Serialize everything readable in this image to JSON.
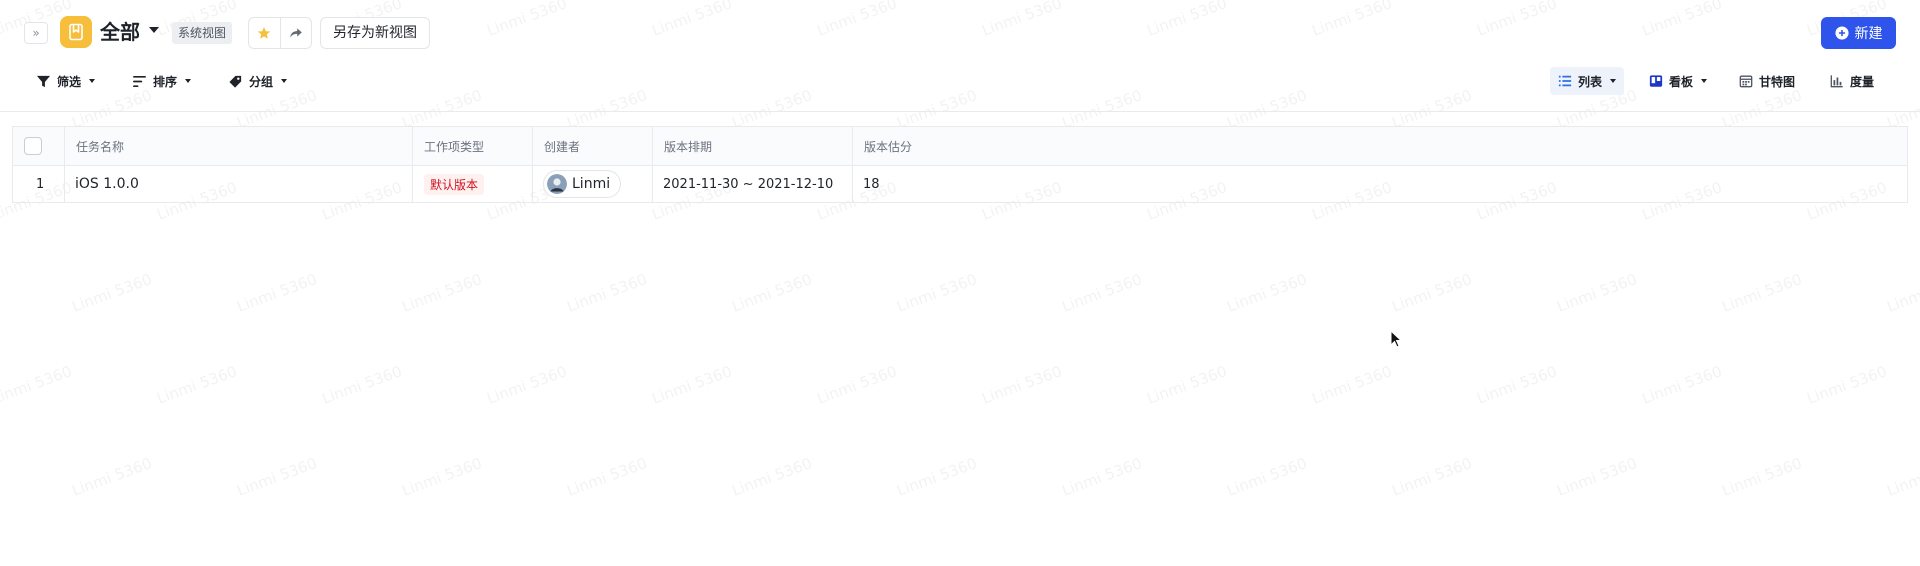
{
  "header": {
    "expand_glyph": "»",
    "view_title": "全部",
    "system_badge": "系统视图",
    "save_as_new_view": "另存为新视图",
    "new_button": "新建",
    "colors": {
      "accent": "#2f54eb",
      "view_icon_bg": "#f6be3a",
      "star": "#f6be3a"
    },
    "icons": [
      "bookmark-icon",
      "star-icon",
      "share-icon",
      "plus-circle-icon"
    ]
  },
  "toolbar": {
    "filter": "筛选",
    "sort": "排序",
    "group": "分组",
    "views": {
      "list": "列表",
      "board": "看板",
      "gantt": "甘特图",
      "metrics": "度量",
      "active": "list"
    }
  },
  "table": {
    "columns": [
      "任务名称",
      "工作项类型",
      "创建者",
      "版本排期",
      "版本估分"
    ],
    "rows": [
      {
        "index": "1",
        "name": "iOS 1.0.0",
        "type": "默认版本",
        "creator": "Linmi",
        "schedule": "2021-11-30 ~ 2021-12-10",
        "estimate": "18"
      }
    ]
  },
  "watermark": "Linmi 5360"
}
